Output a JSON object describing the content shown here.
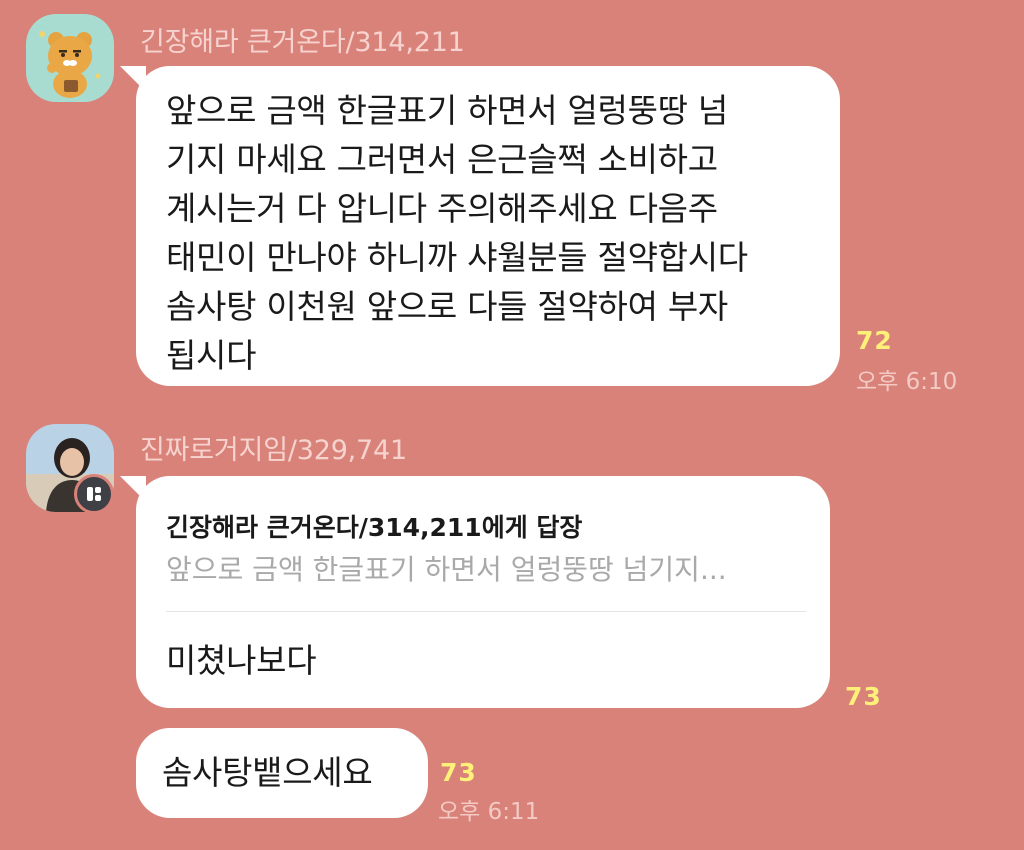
{
  "messages": [
    {
      "sender": "긴장해라 큰거온다/314,211",
      "avatar_icon": "ryan-bear-icon",
      "lines": [
        "앞으로 금액 한글표기 하면서 얼렁뚱땅 넘",
        "기지 마세요 그러면서 은근슬쩍 소비하고",
        "계시는거 다 압니다 주의해주세요 다음주",
        "태민이 만나야 하니까 샤월분들 절약합시다",
        "솜사탕 이천원 앞으로 다들 절약하여 부자",
        "됩시다"
      ],
      "unread": "72",
      "time": "오후 6:10"
    },
    {
      "sender": "진짜로거지임/329,741",
      "avatar_icon": "profile-photo",
      "reply_to_title": "긴장해라 큰거온다/314,211에게 답장",
      "reply_preview": "앞으로 금액 한글표기 하면서 얼렁뚱땅 넘기지...",
      "text": "미쳤나보다",
      "unread": "73"
    },
    {
      "text": "솜사탕뱉으세요",
      "unread": "73",
      "time": "오후 6:11"
    }
  ],
  "colors": {
    "background": "#d9827a",
    "bubble": "#ffffff",
    "unread": "#fff07a"
  }
}
